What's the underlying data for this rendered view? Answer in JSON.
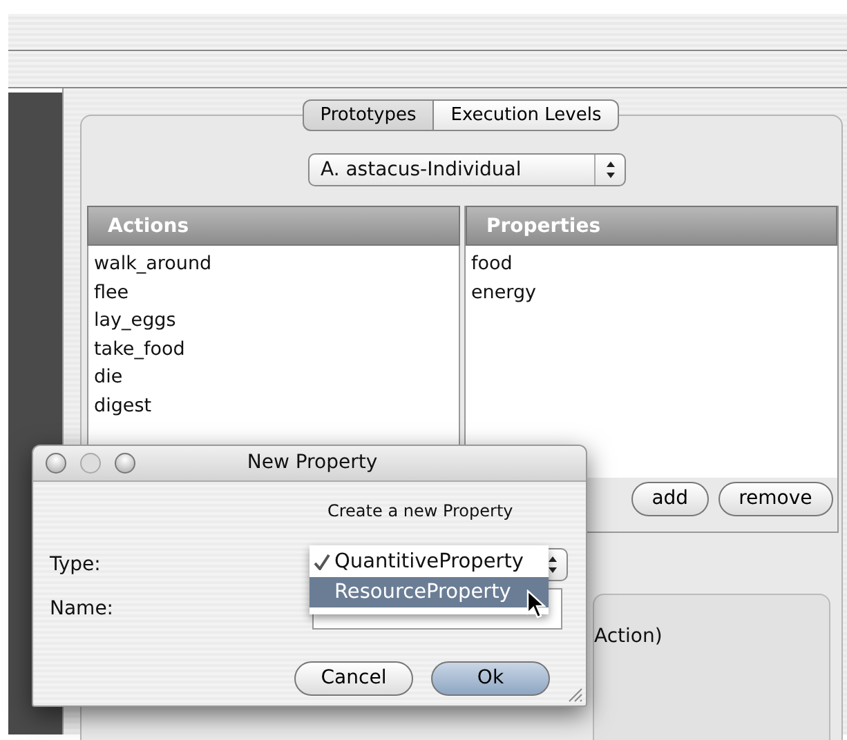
{
  "tabs": [
    {
      "label": "Prototypes",
      "selected": true
    },
    {
      "label": "Execution Levels",
      "selected": false
    }
  ],
  "prototype_select": {
    "value": "A. astacus-Individual"
  },
  "actions": {
    "header": "Actions",
    "items": [
      "walk_around",
      "flee",
      "lay_eggs",
      "take_food",
      "die",
      "digest"
    ]
  },
  "properties": {
    "header": "Properties",
    "items": [
      "food",
      "energy"
    ]
  },
  "property_buttons": [
    "add",
    "remove"
  ],
  "background_fragment": "Action)",
  "dialog": {
    "title": "New Property",
    "prompt": "Create a new Property",
    "fields": [
      {
        "kind": "select",
        "label": "Type:"
      },
      {
        "kind": "text",
        "label": "Name:"
      }
    ],
    "type_menu": [
      {
        "label": "QuantitiveProperty",
        "checked": true,
        "selected": false
      },
      {
        "label": "ResourceProperty",
        "checked": false,
        "selected": true
      }
    ],
    "buttons": [
      {
        "label": "Cancel",
        "default": false
      },
      {
        "label": "Ok",
        "default": true
      }
    ]
  }
}
